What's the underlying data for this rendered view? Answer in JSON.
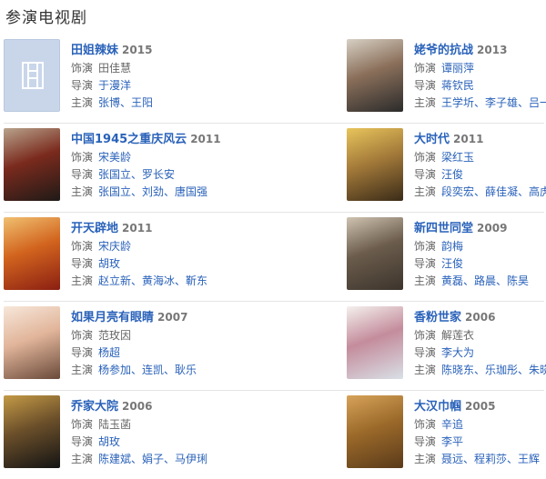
{
  "section_title": "参演电视剧",
  "labels": {
    "role": "饰演",
    "director": "导演",
    "cast": "主演"
  },
  "rows": [
    {
      "left": {
        "title": "田姐辣妹",
        "year": "2015",
        "role": "田佳慧",
        "role_link": false,
        "director": "于漫洋",
        "cast": "张博、王阳",
        "poster": "placeholder-film-icon",
        "colors": [
          "#c9d6ea"
        ]
      },
      "right": {
        "title": "姥爷的抗战",
        "year": "2013",
        "role": "谭丽萍",
        "role_link": true,
        "director": "蒋钦民",
        "cast": "王学圻、李子雄、吕一",
        "poster": "image",
        "colors": [
          "#2b2b2b",
          "#8a6f5a",
          "#d7d0c4"
        ]
      }
    },
    {
      "left": {
        "title": "中国1945之重庆风云",
        "year": "2011",
        "role": "宋美龄",
        "role_link": true,
        "director": "张国立、罗长安",
        "cast": "张国立、刘劲、唐国强",
        "poster": "image",
        "colors": [
          "#1f1a17",
          "#7a2a1d",
          "#b8a38c"
        ]
      },
      "right": {
        "title": "大时代",
        "year": "2011",
        "role": "梁红玉",
        "role_link": true,
        "director": "汪俊",
        "cast": "段奕宏、薛佳凝、高虎",
        "poster": "image",
        "colors": [
          "#3a2b18",
          "#a57b3a",
          "#e8c55c"
        ]
      }
    },
    {
      "left": {
        "title": "开天辟地",
        "year": "2011",
        "role": "宋庆龄",
        "role_link": true,
        "director": "胡玫",
        "cast": "赵立新、黄海冰、靳东",
        "poster": "image",
        "colors": [
          "#8a1f12",
          "#d2641e",
          "#f0c070"
        ]
      },
      "right": {
        "title": "新四世同堂",
        "year": "2009",
        "role": "韵梅",
        "role_link": true,
        "director": "汪俊",
        "cast": "黄磊、路晨、陈昊",
        "poster": "image",
        "colors": [
          "#3c342c",
          "#6b5c4c",
          "#cfc3b1"
        ]
      }
    },
    {
      "left": {
        "title": "如果月亮有眼睛",
        "year": "2007",
        "role": "范玫因",
        "role_link": false,
        "director": "杨超",
        "cast": "杨参加、连凯、耿乐",
        "poster": "image",
        "colors": [
          "#6a4a3a",
          "#e1b59a",
          "#f7e7da"
        ]
      },
      "right": {
        "title": "香粉世家",
        "year": "2006",
        "role": "解莲衣",
        "role_link": false,
        "director": "李大为",
        "cast": "陈晓东、乐珈彤、朱晓渔",
        "poster": "image",
        "colors": [
          "#d9e0e6",
          "#c48c9c",
          "#f4f1ee"
        ]
      }
    },
    {
      "left": {
        "title": "乔家大院",
        "year": "2006",
        "role": "陆玉菡",
        "role_link": false,
        "director": "胡玫",
        "cast": "陈建斌、娟子、马伊琍",
        "poster": "image",
        "colors": [
          "#141414",
          "#6b4f2a",
          "#c49a46"
        ]
      },
      "right": {
        "title": "大汉巾帼",
        "year": "2005",
        "role": "辛追",
        "role_link": true,
        "director": "李平",
        "cast": "聂远、程莉莎、王辉",
        "poster": "image",
        "colors": [
          "#5a3a1a",
          "#9c6a2a",
          "#d7a35a"
        ]
      }
    }
  ]
}
